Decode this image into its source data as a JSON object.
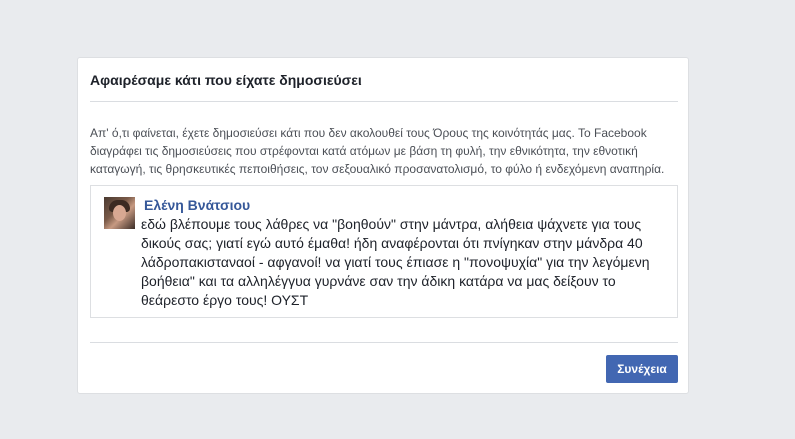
{
  "dialog": {
    "title": "Αφαιρέσαμε κάτι που είχατε δημοσιεύσει",
    "body": "Απ' ό,τι φαίνεται, έχετε δημοσιεύσει κάτι που δεν ακολουθεί τους Όρους της κοινότητάς μας. Το Facebook διαγράφει τις δημοσιεύσεις που στρέφονται κατά ατόμων με βάση τη φυλή, την εθνικότητα, την εθνοτική καταγωγή, τις θρησκευτικές πεποιθήσεις, τον σεξουαλικό προσανατολισμό, το φύλο ή ενδεχόμενη αναπηρία.",
    "post": {
      "author": "Ελένη Βνάτσιου",
      "text": "εδώ βλέπουμε τους λάθρες να \"βοηθούν\" στην μάντρα, αλήθεια ψάχνετε για τους δικούς σας; γιατί εγώ αυτό έμαθα! ήδη αναφέρονται ότι πνίγηκαν στην μάνδρα 40 λάδροπακισταναοί - αφγανοί! να γιατί τους έπιασε η \"πονοψυχία\" για την λεγόμενη βοήθεια\" και τα αλληλέγγυα γυρνάνε σαν την άδικη κατάρα να μας δείξουν το θεάρεστο έργο τους! ΟΥΣΤ"
    },
    "continue_label": "Συνέχεια"
  },
  "colors": {
    "page_background": "#e9ebee",
    "link_blue": "#365899",
    "button_blue": "#4267b2"
  }
}
